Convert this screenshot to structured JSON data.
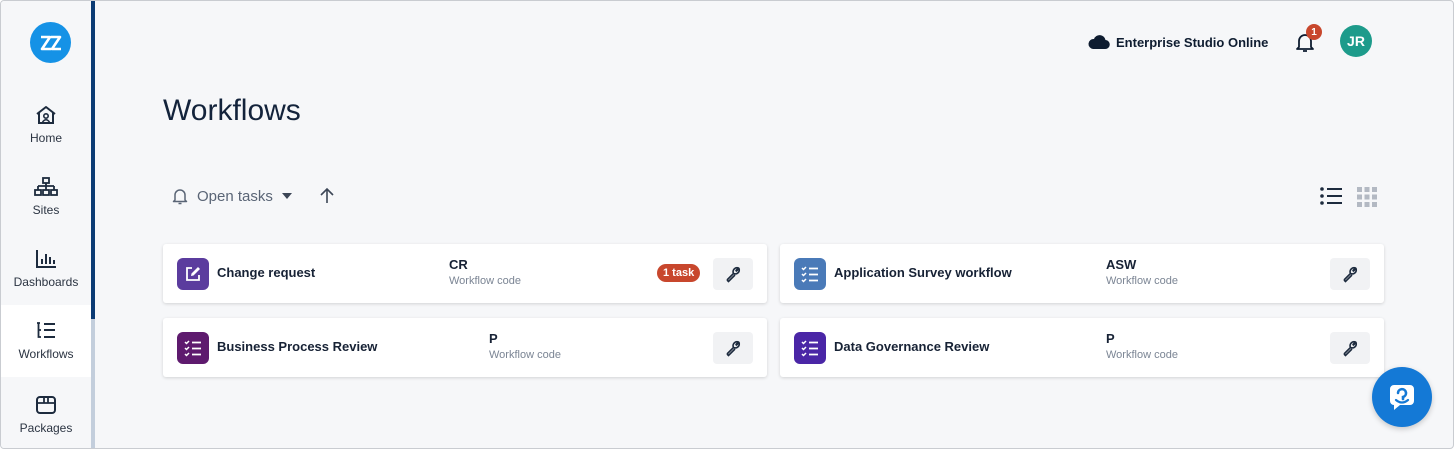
{
  "sidebar": {
    "logo": "zz-logo",
    "items": [
      {
        "label": "Home",
        "icon": "home-icon"
      },
      {
        "label": "Sites",
        "icon": "sitemap-icon"
      },
      {
        "label": "Dashboards",
        "icon": "bar-chart-icon"
      },
      {
        "label": "Workflows",
        "icon": "workflow-icon",
        "active": true
      },
      {
        "label": "Packages",
        "icon": "package-icon"
      }
    ]
  },
  "header": {
    "environment": "Enterprise Studio Online",
    "environment_icon": "cloud-icon",
    "notification_count": "1",
    "avatar_initials": "JR"
  },
  "page": {
    "title": "Workflows"
  },
  "toolbar": {
    "filter_label": "Open tasks",
    "filter_icon": "bell-icon",
    "sort_icon": "arrow-up-icon",
    "view_list_icon": "list-view-icon",
    "view_grid_icon": "grid-view-icon"
  },
  "workflows": [
    {
      "name": "Change request",
      "code": "CR",
      "code_label": "Workflow code",
      "badge": "1 task",
      "icon": "edit-icon",
      "color": "#5b3c9e"
    },
    {
      "name": "Application Survey workflow",
      "code": "ASW",
      "code_label": "Workflow code",
      "icon": "checklist-icon",
      "color": "#4a7ab8"
    },
    {
      "name": "Business Process Review",
      "code": "P",
      "code_label": "Workflow code",
      "icon": "checklist-icon",
      "color": "#5e1a6e"
    },
    {
      "name": "Data Governance Review",
      "code": "P",
      "code_label": "Workflow code",
      "icon": "checklist-icon",
      "color": "#4a26a6"
    }
  ],
  "colors": {
    "brand": "#1592e6",
    "sidebar_accent": "#0b3b74",
    "badge": "#c8472d",
    "avatar": "#1d9b8b",
    "chat_fab": "#1479d6"
  },
  "chat": {
    "icon": "chat-support-icon"
  }
}
